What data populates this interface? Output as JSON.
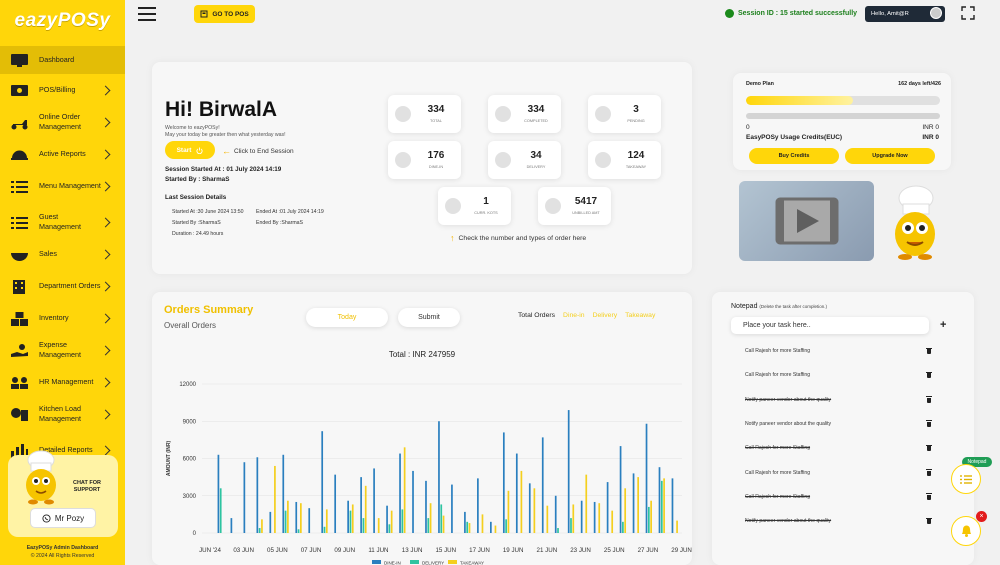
{
  "brand": {
    "logo": "eazyPOSy"
  },
  "sidebar": {
    "items": [
      {
        "label": "Dashboard",
        "icon": "monitor-icon",
        "chevron": false,
        "active": true
      },
      {
        "label": "POS/Billing",
        "icon": "cash-icon",
        "chevron": true
      },
      {
        "label": "Online Order Management",
        "icon": "delivery-scooter-icon",
        "chevron": true
      },
      {
        "label": "Active Reports",
        "icon": "food-cloche-icon",
        "chevron": true
      },
      {
        "label": "Menu Management",
        "icon": "menu-list-icon",
        "chevron": true
      },
      {
        "label": "Guest Management",
        "icon": "guest-list-icon",
        "chevron": true
      },
      {
        "label": "Sales",
        "icon": "bowl-icon",
        "chevron": true
      },
      {
        "label": "Department Orders",
        "icon": "building-icon",
        "chevron": true
      },
      {
        "label": "Inventory",
        "icon": "boxes-icon",
        "chevron": true
      },
      {
        "label": "Expense Management",
        "icon": "hand-money-icon",
        "chevron": true
      },
      {
        "label": "HR Management",
        "icon": "hr-people-icon",
        "chevron": true
      },
      {
        "label": "Kitchen Load Management",
        "icon": "kitchen-load-icon",
        "chevron": true
      },
      {
        "label": "Detailed Reports",
        "icon": "bar-chart-icon",
        "chevron": true
      }
    ],
    "support_text": "CHAT FOR SUPPORT",
    "support_button": "Mr Pozy",
    "footer_line1": "EazyPOSy Admin Dashboard",
    "footer_line2": "© 2024 All Rights Reserved"
  },
  "topbar": {
    "go_pos": "GO TO POS",
    "session_status": "Session ID : 15 started successfully",
    "user": "Hello, Amit@R"
  },
  "hero": {
    "greeting": "Hi! BirwalA",
    "welcome_1": "Welcome to eazyPOSy!",
    "welcome_2": "May your today be greater then what yesterday was!",
    "start_label": "Start",
    "end_hint": "Click to End Session",
    "session_started": "Session Started At : 01 July 2024 14:19",
    "started_by": "Started By : SharmaS",
    "last_title": "Last Session Details",
    "last_started_at": "Started At :30 June 2024 13:50",
    "last_started_by": "Started By :SharmaS",
    "last_duration": "Duration : 24.49 hours",
    "last_ended_at": "Ended At :01 July 2024 14:19",
    "last_ended_by": "Ended By :SharmaS",
    "check_hint": "Check the number and types of order here"
  },
  "stats": [
    {
      "value": "334",
      "label": "TOTAL"
    },
    {
      "value": "334",
      "label": "COMPLETED"
    },
    {
      "value": "3",
      "label": "PENDING"
    },
    {
      "value": "176",
      "label": "DINE-IN"
    },
    {
      "value": "34",
      "label": "DELIVERY"
    },
    {
      "value": "124",
      "label": "TAKEAWAY"
    },
    {
      "value": "1",
      "label": "CURR. KOTS"
    },
    {
      "value": "5417",
      "label": "UNBILLED AMT"
    }
  ],
  "plan": {
    "name": "Demo Plan",
    "days_left": "162 days left/426",
    "progress": 0.55,
    "credits_left": "0",
    "credits_value": "INR 0",
    "credits_label": "EasyPOSy Usage Credits(EUC)",
    "credits_total": "INR 0",
    "buy_credits": "Buy Credits",
    "upgrade": "Upgrade Now"
  },
  "orders": {
    "title": "Orders Summary",
    "subtitle": "Overall Orders",
    "today": "Today",
    "submit": "Submit",
    "tabs": [
      "Total Orders",
      "Dine-in",
      "Delivery",
      "Takeaway"
    ],
    "total_text": "Total : INR 247959"
  },
  "chart_data": {
    "type": "bar",
    "x": [
      "JUN '24",
      "03 JUN",
      "05 JUN",
      "07 JUN",
      "09 JUN",
      "11 JUN",
      "13 JUN",
      "15 JUN",
      "17 JUN",
      "19 JUN",
      "21 JUN",
      "23 JUN",
      "25 JUN",
      "27 JUN",
      "29 JUN"
    ],
    "ylabel": "AMOUNT (INR)",
    "ylim": [
      0,
      12000
    ],
    "yticks": [
      "0",
      "3000",
      "6000",
      "9000",
      "12000"
    ],
    "series": [
      {
        "name": "DINE-IN",
        "color": "#2a7fbf",
        "values": [
          0,
          6300,
          1200,
          5700,
          6100,
          1700,
          6300,
          2500,
          2000,
          8200,
          4700,
          2600,
          4500,
          5200,
          2200,
          6400,
          5000,
          4200,
          9000,
          3900,
          1700,
          4400,
          900,
          8100,
          6400,
          4000,
          7700,
          3000,
          9900,
          2600,
          2500,
          4100,
          7000,
          4800,
          8800,
          5300,
          4400
        ]
      },
      {
        "name": "DELIVERY",
        "color": "#2ec4a0",
        "values": [
          0,
          3600,
          0,
          0,
          400,
          0,
          1800,
          300,
          0,
          500,
          0,
          1800,
          1200,
          0,
          700,
          1900,
          0,
          1200,
          2300,
          0,
          900,
          0,
          0,
          1100,
          0,
          0,
          0,
          400,
          1200,
          0,
          0,
          0,
          900,
          0,
          2100,
          4200,
          0
        ]
      },
      {
        "name": "TAKEAWAY",
        "color": "#f4cf1e",
        "values": [
          0,
          0,
          0,
          0,
          1100,
          5400,
          2600,
          2400,
          0,
          1900,
          0,
          2300,
          3800,
          1200,
          1800,
          6900,
          0,
          2400,
          1400,
          0,
          800,
          1500,
          600,
          3400,
          5000,
          3600,
          2200,
          0,
          2300,
          4700,
          2400,
          1800,
          3600,
          4500,
          2600,
          4400,
          1000
        ]
      }
    ]
  },
  "notepad": {
    "title": "Notepad",
    "hint": "(Delete the task after completion.)",
    "placeholder": "Place your task here..",
    "tasks": [
      {
        "text": "Call Rajesh for more Staffing",
        "done": false
      },
      {
        "text": "Call Rajesh for more Staffing",
        "done": false
      },
      {
        "text": "Notify paneer vendor about the quality",
        "done": true
      },
      {
        "text": "Notify paneer vendor about the quality",
        "done": false
      },
      {
        "text": "Call Rajesh for more Staffing",
        "done": true
      },
      {
        "text": "Call Rajesh for more Staffing",
        "done": false
      },
      {
        "text": "Call Rajesh for more Staffing",
        "done": true
      },
      {
        "text": "Notify paneer vendor about the quality",
        "done": true
      }
    ],
    "float_tag": "Notepad"
  }
}
